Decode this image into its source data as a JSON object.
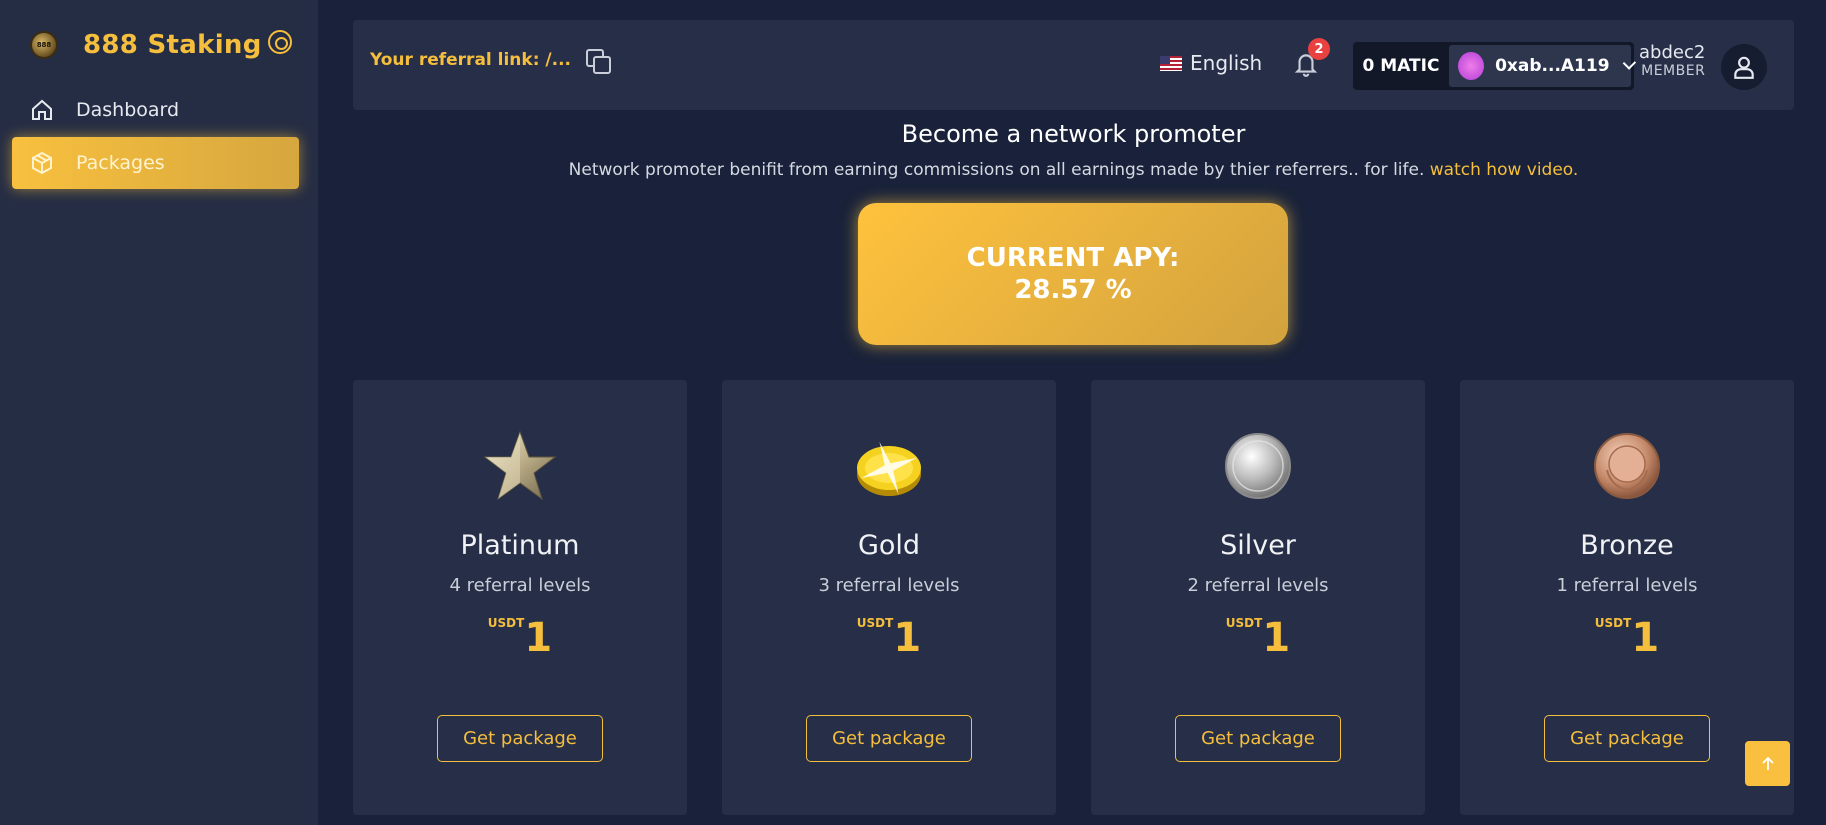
{
  "sidebar": {
    "brand": "888 Staking",
    "logo_text": "888",
    "items": [
      {
        "label": "Dashboard",
        "icon": "home-icon",
        "active": false
      },
      {
        "label": "Packages",
        "icon": "package-icon",
        "active": true
      }
    ]
  },
  "header": {
    "referral_label": "Your referral link: /...",
    "language": "English",
    "notification_count": "2",
    "balance": "0 MATIC",
    "address": "0xab...A119",
    "username": "abdec2",
    "role": "MEMBER"
  },
  "promo": {
    "title": "Become a network promoter",
    "text": "Network promoter benifit from earning commissions on all earnings made by thier referrers.. for life.",
    "link": "watch how video."
  },
  "apy": {
    "label": "CURRENT APY:",
    "value": "28.57 %"
  },
  "packages": [
    {
      "name": "Platinum",
      "levels": "4 referral levels",
      "currency": "USDT",
      "amount": "1",
      "button": "Get package",
      "icon": "star-icon"
    },
    {
      "name": "Gold",
      "levels": "3 referral levels",
      "currency": "USDT",
      "amount": "1",
      "button": "Get package",
      "icon": "gold-coin-icon"
    },
    {
      "name": "Silver",
      "levels": "2 referral levels",
      "currency": "USDT",
      "amount": "1",
      "button": "Get package",
      "icon": "silver-coin-icon"
    },
    {
      "name": "Bronze",
      "levels": "1 referral levels",
      "currency": "USDT",
      "amount": "1",
      "button": "Get package",
      "icon": "bronze-medal-icon"
    }
  ],
  "colors": {
    "accent": "#f5be3d",
    "background": "#19223a",
    "panel": "#262f47",
    "badge": "#e8413f"
  }
}
